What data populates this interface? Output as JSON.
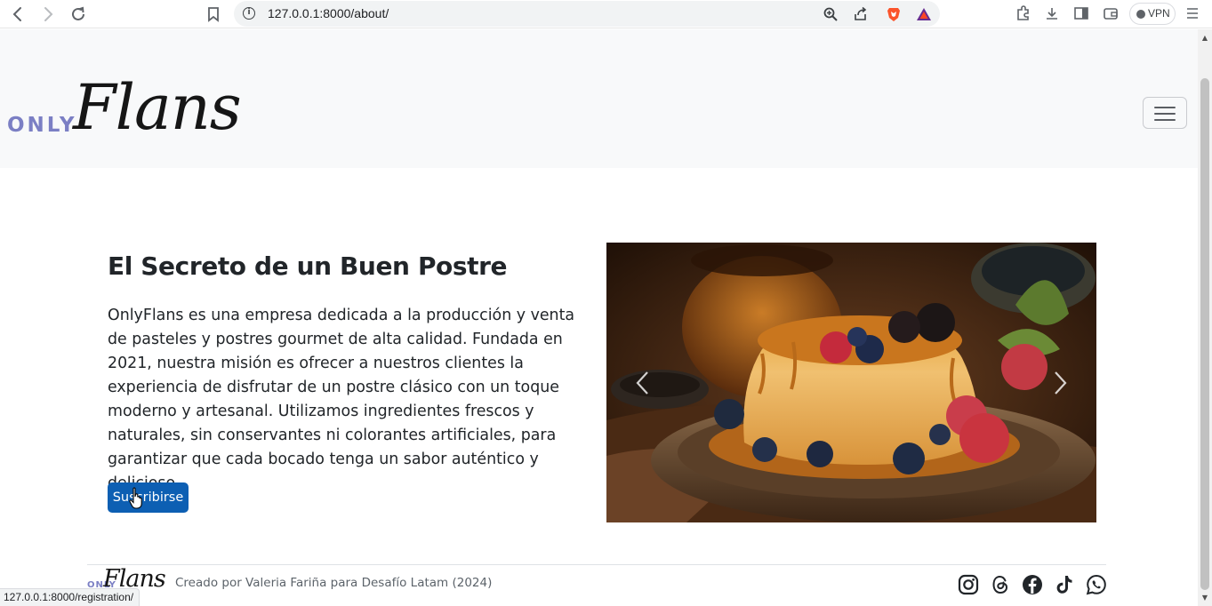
{
  "browser": {
    "url": "127.0.0.1:8000/about/",
    "vpn_label": "VPN",
    "status_url": "127.0.0.1:8000/registration/"
  },
  "navbar": {
    "logo_only": "ONLY",
    "logo_flans": "Flans"
  },
  "about": {
    "title": "El Secreto de un Buen Postre",
    "description": "OnlyFlans es una empresa dedicada a la producción y venta de pasteles y postres gourmet de alta calidad. Fundada en 2021, nuestra misión es ofrecer a nuestros clientes la experiencia de disfrutar de un postre clásico con un toque moderno y artesanal. Utilizamos ingredientes frescos y naturales, sin conservantes ni colorantes artificiales, para garantizar que cada bocado tenga un sabor auténtico y delicioso.",
    "button_label": "Suscribirse"
  },
  "carousel": {
    "image": "flan-with-berries-photo"
  },
  "footer": {
    "logo_only": "ONLY",
    "logo_flans": "Flans",
    "credit": "Creado por Valeria Fariña para Desafío Latam (2024)",
    "social_icons": [
      "instagram-icon",
      "threads-icon",
      "facebook-icon",
      "tiktok-icon",
      "whatsapp-icon"
    ]
  },
  "colors": {
    "primary_button": "#0d5fb3",
    "logo_accent": "#7b7fc4",
    "navbar_bg": "#f8f9fa",
    "text": "#212529"
  }
}
